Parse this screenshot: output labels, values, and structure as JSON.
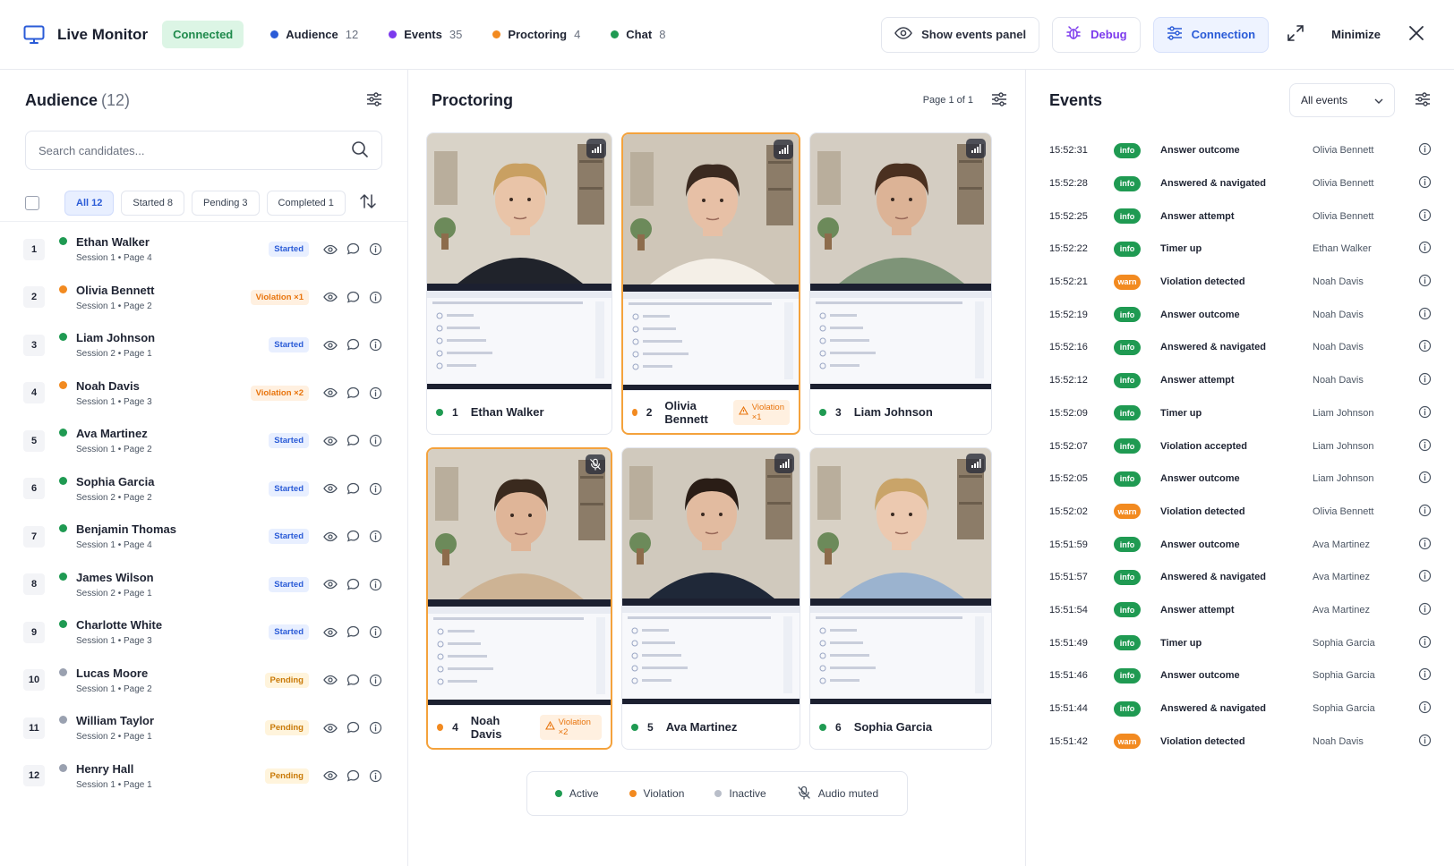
{
  "header": {
    "title": "Live Monitor",
    "connection_status": "Connected",
    "counters": [
      {
        "label": "Audience",
        "value": "12",
        "color": "#2a5bd7"
      },
      {
        "label": "Events",
        "value": "35",
        "color": "#7c3aed"
      },
      {
        "label": "Proctoring",
        "value": "4",
        "color": "#f28a20"
      },
      {
        "label": "Chat",
        "value": "8",
        "color": "#1f9a52"
      }
    ],
    "show_events_label": "Show events panel",
    "debug_label": "Debug",
    "connection_label": "Connection",
    "minimize_label": "Minimize"
  },
  "audience": {
    "title": "Audience",
    "count": "(12)",
    "search_placeholder": "Search candidates...",
    "filters": [
      "All 12",
      "Started 8",
      "Pending 3",
      "Completed 1"
    ],
    "candidates": [
      {
        "index": "1",
        "name": "Ethan Walker",
        "meta": "Session 1 • Page 4",
        "status": "Started",
        "kind": "started",
        "color": "#1f9a52"
      },
      {
        "index": "2",
        "name": "Olivia Bennett",
        "meta": "Session 1 • Page 2",
        "status": "Violation ×1",
        "kind": "violation",
        "color": "#f28a20"
      },
      {
        "index": "3",
        "name": "Liam Johnson",
        "meta": "Session 2 • Page 1",
        "status": "Started",
        "kind": "started",
        "color": "#1f9a52"
      },
      {
        "index": "4",
        "name": "Noah Davis",
        "meta": "Session 1 • Page 3",
        "status": "Violation ×2",
        "kind": "violation",
        "color": "#f28a20"
      },
      {
        "index": "5",
        "name": "Ava Martinez",
        "meta": "Session 1 • Page 2",
        "status": "Started",
        "kind": "started",
        "color": "#1f9a52"
      },
      {
        "index": "6",
        "name": "Sophia Garcia",
        "meta": "Session 2 • Page 2",
        "status": "Started",
        "kind": "started",
        "color": "#1f9a52"
      },
      {
        "index": "7",
        "name": "Benjamin Thomas",
        "meta": "Session 1 • Page 4",
        "status": "Started",
        "kind": "started",
        "color": "#1f9a52"
      },
      {
        "index": "8",
        "name": "James Wilson",
        "meta": "Session 2 • Page 1",
        "status": "Started",
        "kind": "started",
        "color": "#1f9a52"
      },
      {
        "index": "9",
        "name": "Charlotte White",
        "meta": "Session 1 • Page 3",
        "status": "Started",
        "kind": "started",
        "color": "#1f9a52"
      },
      {
        "index": "10",
        "name": "Lucas Moore",
        "meta": "Session 1 • Page 2",
        "status": "Pending",
        "kind": "pending",
        "color": "#9aa1b0"
      },
      {
        "index": "11",
        "name": "William Taylor",
        "meta": "Session 2 • Page 1",
        "status": "Pending",
        "kind": "pending",
        "color": "#9aa1b0"
      },
      {
        "index": "12",
        "name": "Henry Hall",
        "meta": "Session 1 • Page 1",
        "status": "Pending",
        "kind": "pending",
        "color": "#9aa1b0"
      }
    ]
  },
  "proctoring": {
    "title": "Proctoring",
    "page_info": "Page 1 of 1",
    "tiles": [
      {
        "index": "1",
        "name": "Ethan Walker",
        "violation": "",
        "color": "#1f9a52",
        "skin": "#e9c4a8",
        "hair": "#c9a062",
        "shirt": "#20232b",
        "bg": "#d9d3c8",
        "muted": false
      },
      {
        "index": "2",
        "name": "Olivia Bennett",
        "violation": "Violation ×1",
        "color": "#f28a20",
        "skin": "#e7c0a6",
        "hair": "#3b2a20",
        "shirt": "#f4efe7",
        "bg": "#cfc6b8",
        "muted": false
      },
      {
        "index": "3",
        "name": "Liam Johnson",
        "violation": "",
        "color": "#1f9a52",
        "skin": "#dcb396",
        "hair": "#4a3020",
        "shirt": "#7e9478",
        "bg": "#d4cdc2",
        "muted": false
      },
      {
        "index": "4",
        "name": "Noah Davis",
        "violation": "Violation ×2",
        "color": "#f28a20",
        "skin": "#dfb598",
        "hair": "#3a2a1e",
        "shirt": "#cdb394",
        "bg": "#d6cfc3",
        "muted": true
      },
      {
        "index": "5",
        "name": "Ava Martinez",
        "violation": "",
        "color": "#1f9a52",
        "skin": "#e2bba0",
        "hair": "#2a1d16",
        "shirt": "#1f2838",
        "bg": "#d0c9bd",
        "muted": false
      },
      {
        "index": "6",
        "name": "Sophia Garcia",
        "violation": "",
        "color": "#1f9a52",
        "skin": "#ecc9b0",
        "hair": "#c9a469",
        "shirt": "#9bb3cf",
        "bg": "#d8d1c5",
        "muted": false
      }
    ],
    "legend": [
      {
        "label": "Active",
        "color": "#1f9a52"
      },
      {
        "label": "Violation",
        "color": "#f28a20"
      },
      {
        "label": "Inactive",
        "color": "#b9bec9"
      }
    ],
    "legend_muted_label": "Audio muted"
  },
  "events": {
    "title": "Events",
    "filter_value": "All events",
    "items": [
      {
        "time": "15:52:31",
        "level": "info",
        "desc": "Answer outcome",
        "user": "Olivia Bennett"
      },
      {
        "time": "15:52:28",
        "level": "info",
        "desc": "Answered & navigated",
        "user": "Olivia Bennett"
      },
      {
        "time": "15:52:25",
        "level": "info",
        "desc": "Answer attempt",
        "user": "Olivia Bennett"
      },
      {
        "time": "15:52:22",
        "level": "info",
        "desc": "Timer up",
        "user": "Ethan Walker"
      },
      {
        "time": "15:52:21",
        "level": "warn",
        "desc": "Violation detected",
        "user": "Noah Davis"
      },
      {
        "time": "15:52:19",
        "level": "info",
        "desc": "Answer outcome",
        "user": "Noah Davis"
      },
      {
        "time": "15:52:16",
        "level": "info",
        "desc": "Answered & navigated",
        "user": "Noah Davis"
      },
      {
        "time": "15:52:12",
        "level": "info",
        "desc": "Answer attempt",
        "user": "Noah Davis"
      },
      {
        "time": "15:52:09",
        "level": "info",
        "desc": "Timer up",
        "user": "Liam Johnson"
      },
      {
        "time": "15:52:07",
        "level": "info",
        "desc": "Violation accepted",
        "user": "Liam Johnson"
      },
      {
        "time": "15:52:05",
        "level": "info",
        "desc": "Answer outcome",
        "user": "Liam Johnson"
      },
      {
        "time": "15:52:02",
        "level": "warn",
        "desc": "Violation detected",
        "user": "Olivia Bennett"
      },
      {
        "time": "15:51:59",
        "level": "info",
        "desc": "Answer outcome",
        "user": "Ava Martinez"
      },
      {
        "time": "15:51:57",
        "level": "info",
        "desc": "Answered & navigated",
        "user": "Ava Martinez"
      },
      {
        "time": "15:51:54",
        "level": "info",
        "desc": "Answer attempt",
        "user": "Ava Martinez"
      },
      {
        "time": "15:51:49",
        "level": "info",
        "desc": "Timer up",
        "user": "Sophia Garcia"
      },
      {
        "time": "15:51:46",
        "level": "info",
        "desc": "Answer outcome",
        "user": "Sophia Garcia"
      },
      {
        "time": "15:51:44",
        "level": "info",
        "desc": "Answered & navigated",
        "user": "Sophia Garcia"
      },
      {
        "time": "15:51:42",
        "level": "warn",
        "desc": "Violation detected",
        "user": "Noah Davis"
      }
    ]
  }
}
